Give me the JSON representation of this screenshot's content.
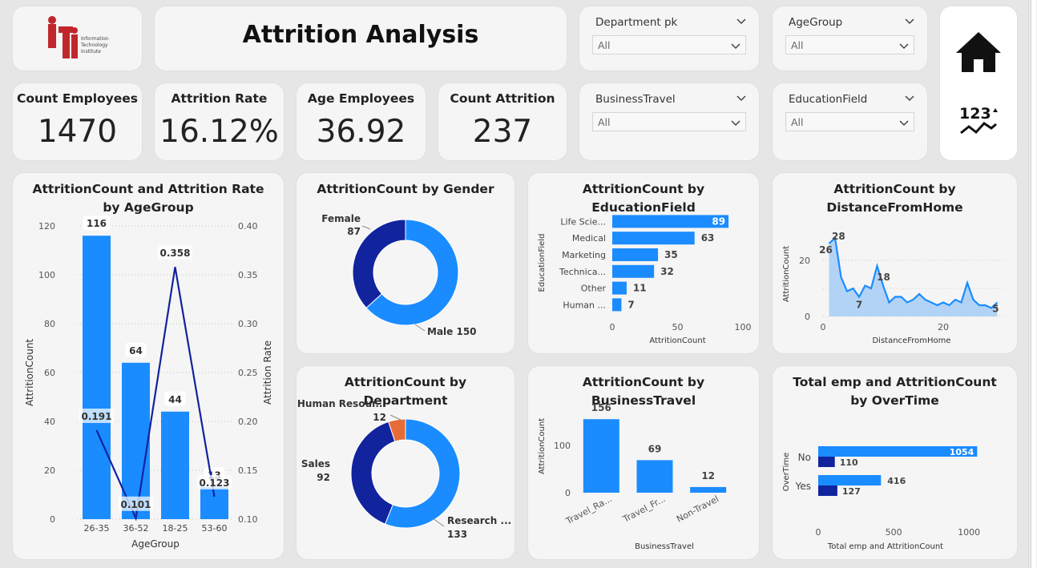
{
  "title": "Attrition Analysis",
  "logo": {
    "mark": "iTi",
    "line1": "Information",
    "line2": "Technology",
    "line3": "Institute"
  },
  "kpis": [
    {
      "title": "Count Employees",
      "value": "1470"
    },
    {
      "title": "Attrition Rate",
      "value": "16.12%"
    },
    {
      "title": "Age Employees",
      "value": "36.92"
    },
    {
      "title": "Count Attrition",
      "value": "237"
    }
  ],
  "slicers": {
    "department": {
      "title": "Department pk",
      "value": "All"
    },
    "agegroup": {
      "title": "AgeGroup",
      "value": "All"
    },
    "businesstravel": {
      "title": "BusinessTravel",
      "value": "All"
    },
    "educationfield": {
      "title": "EducationField",
      "value": "All"
    }
  },
  "nav": {
    "home_icon": "home-icon",
    "numbers_icon": "123-trend-icon",
    "numbers_text": "123"
  },
  "colors": {
    "blue": "#1a8cff",
    "navy": "#12239e",
    "orange": "#e66c37",
    "area": "#a6cdf5"
  },
  "chart_data": [
    {
      "id": "age",
      "type": "bar",
      "title": "AttritionCount and Attrition Rate by AgeGroup",
      "xlabel": "AgeGroup",
      "ylabel": "AttritionCount",
      "y2label": "Attrition Rate",
      "categories": [
        "26-35",
        "36-52",
        "18-25",
        "53-60"
      ],
      "series": [
        {
          "name": "AttritionCount",
          "values": [
            116,
            64,
            44,
            13
          ],
          "labels": [
            "116",
            "64",
            "44",
            "13"
          ]
        },
        {
          "name": "Attrition Rate",
          "values": [
            0.191,
            0.101,
            0.358,
            0.123
          ],
          "labels": [
            "0.191",
            "0.101",
            "0.358",
            "0.123"
          ]
        }
      ],
      "ylim": [
        0,
        120
      ],
      "yticks": [
        "0",
        "20",
        "40",
        "60",
        "80",
        "100",
        "120"
      ],
      "y2lim": [
        0.1,
        0.4
      ],
      "y2ticks": [
        "0.10",
        "0.15",
        "0.20",
        "0.25",
        "0.30",
        "0.35",
        "0.40"
      ],
      "grid": true
    },
    {
      "id": "gender",
      "type": "pie",
      "title": "AttritionCount by Gender",
      "slices": [
        {
          "label": "Male",
          "value": 150,
          "value_text": "150"
        },
        {
          "label": "Female",
          "value": 87,
          "value_text": "87"
        }
      ]
    },
    {
      "id": "education",
      "type": "bar",
      "orientation": "horizontal",
      "title": "AttritionCount by EducationField",
      "xlabel": "AttritionCount",
      "ylabel": "EducationField",
      "categories": [
        "Life Scie...",
        "Medical",
        "Marketing",
        "Technica...",
        "Other",
        "Human ..."
      ],
      "values": [
        89,
        63,
        35,
        32,
        11,
        7
      ],
      "value_labels": [
        "89",
        "63",
        "35",
        "32",
        "11",
        "7"
      ],
      "xlim": [
        0,
        100
      ],
      "xticks": [
        "0",
        "50",
        "100"
      ]
    },
    {
      "id": "distance",
      "type": "area",
      "title": "AttritionCount by DistanceFromHome",
      "xlabel": "DistanceFromHome",
      "ylabel": "AttritionCount",
      "x": [
        1,
        2,
        3,
        4,
        5,
        6,
        7,
        8,
        9,
        10,
        11,
        12,
        13,
        14,
        15,
        16,
        17,
        18,
        19,
        20,
        21,
        22,
        23,
        24,
        25,
        26,
        27,
        28,
        29
      ],
      "y": [
        26,
        28,
        14,
        9,
        10,
        7,
        11,
        10,
        18,
        11,
        5,
        7,
        7,
        5,
        6,
        8,
        6,
        5,
        4,
        5,
        4,
        6,
        5,
        12,
        6,
        4,
        4,
        3,
        5
      ],
      "point_labels": [
        "26",
        "28",
        "7",
        "18",
        "5"
      ],
      "xlim": [
        0,
        30
      ],
      "xticks": [
        "0",
        "20"
      ],
      "ylim": [
        0,
        30
      ],
      "yticks": [
        "0",
        "20"
      ],
      "grid": true
    },
    {
      "id": "department",
      "type": "pie",
      "title": "AttritionCount by Department",
      "slices": [
        {
          "label": "Research ...",
          "value": 133,
          "value_text": "133"
        },
        {
          "label": "Sales",
          "value": 92,
          "value_text": "92"
        },
        {
          "label": "Human Resour...",
          "value": 12,
          "value_text": "12"
        }
      ]
    },
    {
      "id": "travel",
      "type": "bar",
      "title": "AttritionCount by BusinessTravel",
      "xlabel": "BusinessTravel",
      "ylabel": "AttritionCount",
      "categories": [
        "Travel_Ra...",
        "Travel_Fr...",
        "Non-Travel"
      ],
      "values": [
        156,
        69,
        12
      ],
      "value_labels": [
        "156",
        "69",
        "12"
      ],
      "ylim": [
        0,
        170
      ],
      "yticks": [
        "0",
        "100"
      ]
    },
    {
      "id": "overtime",
      "type": "bar",
      "orientation": "horizontal",
      "title": "Total emp and AttritionCount by OverTime",
      "xlabel": "Total emp and AttritionCount",
      "ylabel": "OverTime",
      "categories": [
        "No",
        "Yes"
      ],
      "series": [
        {
          "name": "Total emp",
          "values": [
            1054,
            416
          ],
          "labels": [
            "1054",
            "416"
          ]
        },
        {
          "name": "AttritionCount",
          "values": [
            110,
            127
          ],
          "labels": [
            "110",
            "127"
          ]
        }
      ],
      "xlim": [
        0,
        1100
      ],
      "xticks": [
        "0",
        "500",
        "1000"
      ]
    }
  ]
}
